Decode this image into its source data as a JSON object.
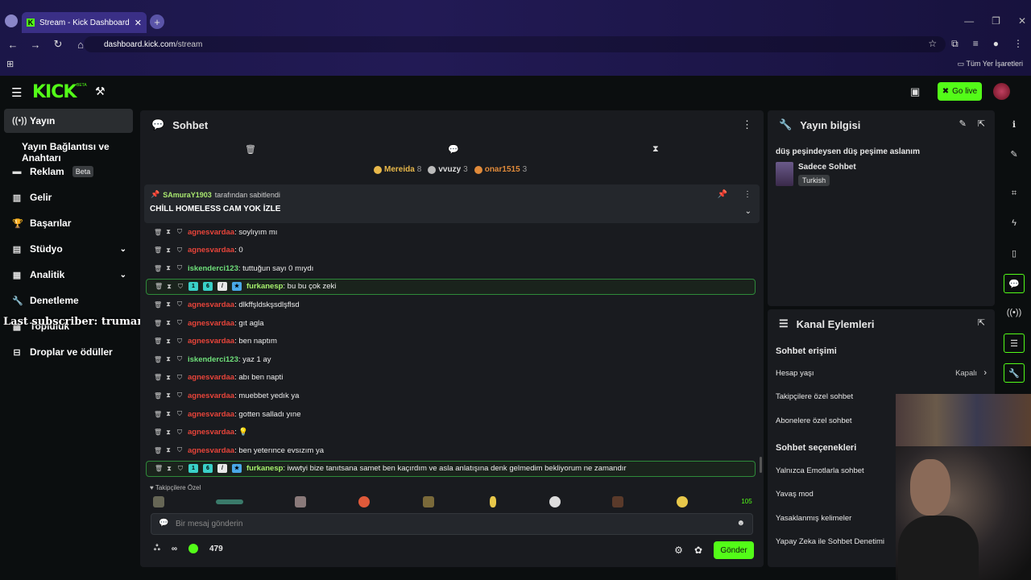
{
  "browser": {
    "tab_title": "Stream - Kick Dashboard",
    "url_host": "dashboard.kick.com",
    "url_path": "/stream",
    "bookmarks_all": "Tüm Yer İşaretleri"
  },
  "header": {
    "logo": "KICK",
    "logo_sup": "BETA",
    "go_live": "Go live"
  },
  "sidebar": {
    "items": [
      {
        "label": "Yayın"
      },
      {
        "label": "Yayın Bağlantısı ve Anahtarı"
      },
      {
        "label": "Reklam",
        "badge": "Beta"
      },
      {
        "label": "Gelir"
      },
      {
        "label": "Başarılar"
      },
      {
        "label": "Stüdyo"
      },
      {
        "label": "Analitik"
      },
      {
        "label": "Denetleme"
      },
      {
        "label": "Topluluk"
      },
      {
        "label": "Droplar ve ödüller"
      }
    ],
    "overlay_text": "Last subscriber: trumansov"
  },
  "chat": {
    "title": "Sohbet",
    "leaderboard": [
      {
        "name": "Mereida",
        "count": "8",
        "color": "#e8b84a"
      },
      {
        "name": "vvuzy",
        "count": "3",
        "color": "#bbbbbb"
      },
      {
        "name": "onar1515",
        "count": "3",
        "color": "#e08a3a"
      }
    ],
    "pinned": {
      "user": "SAmuraY1903",
      "suffix": "tarafından sabitlendi",
      "message": "CHİLL HOMELESS CAM YOK İZLE"
    },
    "messages": [
      {
        "user": "agnesvardaa",
        "text": ": soylıyım mı",
        "color": "red"
      },
      {
        "user": "agnesvardaa",
        "text": ": 0",
        "color": "red"
      },
      {
        "user": "iskenderci123",
        "text": ": tuttuğun sayı 0 mıydı",
        "color": "green"
      },
      {
        "user": "furkanesp",
        "text": ": bu bu çok zeki",
        "color": "lime",
        "highlight": true
      },
      {
        "user": "agnesvardaa",
        "text": ": dlkffşldskşsdlşflsd",
        "color": "red"
      },
      {
        "user": "agnesvardaa",
        "text": ": gıt agla",
        "color": "red"
      },
      {
        "user": "agnesvardaa",
        "text": ": ben naptım",
        "color": "red"
      },
      {
        "user": "iskenderci123",
        "text": ": yaz 1 ay",
        "color": "green"
      },
      {
        "user": "agnesvardaa",
        "text": ": abı ben napti",
        "color": "red"
      },
      {
        "user": "agnesvardaa",
        "text": ": muebbet yedık ya",
        "color": "red"
      },
      {
        "user": "agnesvardaa",
        "text": ": gotten salladı yıne",
        "color": "red"
      },
      {
        "user": "agnesvardaa",
        "text": ":  💡",
        "color": "red"
      },
      {
        "user": "agnesvardaa",
        "text": ": ben yeterınce evsızım ya",
        "color": "red"
      },
      {
        "user": "furkanesp",
        "text": ": iwwtyi bize tanıtsana samet ben kaçırdım ve asla anlatışına denk gelmedim bekliyorum ne zamandır",
        "color": "lime",
        "highlight": true
      }
    ],
    "followers_label": "Takipçilere Özel",
    "emote_last": "105",
    "input_placeholder": "Bir mesaj gönderin",
    "points": "479",
    "infinity": "∞",
    "send": "Gönder"
  },
  "stream_info": {
    "title": "Yayın bilgisi",
    "stream_title": "düş peşindeysen düş peşime aslanım",
    "category": "Sadece Sohbet",
    "language": "Turkish"
  },
  "channel_actions": {
    "title": "Kanal Eylemleri",
    "section1": "Sohbet erişimi",
    "slow_age_label": "Hesap yaşı",
    "slow_age_value": "Kapalı",
    "followers_only": "Takipçilere özel sohbet",
    "subscribers_only": "Abonelere özel sohbet",
    "section2": "Sohbet seçenekleri",
    "emote_only": "Yalnızca Emotlarla sohbet",
    "slow_mode": "Yavaş mod",
    "banned_words": "Yasaklanmış kelimeler",
    "ai_moderation": "Yapay Zeka ile Sohbet Denetimi"
  },
  "colors": {
    "accent": "#53fc18",
    "user_red": "#e8443a",
    "user_green": "#6fe07a"
  }
}
